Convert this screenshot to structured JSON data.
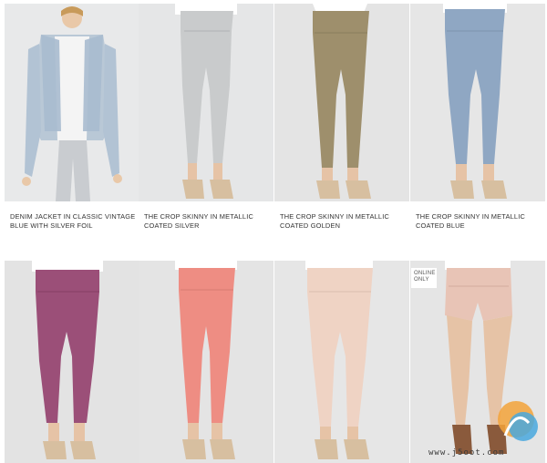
{
  "products": [
    {
      "caption": "DENIM JACKET IN CLASSIC VINTAGE BLUE WITH SILVER FOIL",
      "color": "#c4cdd6"
    },
    {
      "caption": "THE CROP SKINNY IN METALLIC COATED SILVER",
      "color": "#c9cbcc"
    },
    {
      "caption": "THE CROP SKINNY IN METALLIC COATED GOLDEN",
      "color": "#9e8f6c"
    },
    {
      "caption": "THE CROP SKINNY IN METALLIC COATED BLUE",
      "color": "#8fa7c3"
    },
    {
      "caption": "",
      "color": "#9b4f78"
    },
    {
      "caption": "",
      "color": "#ee8d83"
    },
    {
      "caption": "",
      "color": "#efd3c4"
    },
    {
      "caption": "",
      "color": "#e8c4b6",
      "badge": [
        "ONLINE",
        "ONLY"
      ]
    }
  ],
  "watermark": {
    "text": "www.j5oot.com"
  }
}
